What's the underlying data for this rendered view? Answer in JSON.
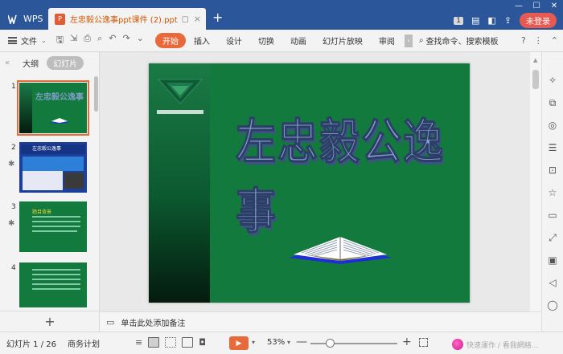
{
  "titlebar": {
    "app_tab_label": "WPS",
    "doc_tab_label": "左忠毅公逸事ppt课件 (2).ppt",
    "new_tab": "+",
    "page_badge": "1",
    "login_label": "未登录"
  },
  "menubar": {
    "file_label": "文件",
    "tabs": [
      "开始",
      "插入",
      "设计",
      "切换",
      "动画",
      "幻灯片放映",
      "审阅"
    ],
    "active_tab": "开始",
    "search_label": "查找命令、搜索模板",
    "help": "?"
  },
  "leftpanel": {
    "outline_tab": "大纲",
    "slides_tab": "幻灯片",
    "active_tab": "幻灯片",
    "thumbnails": [
      {
        "number": "1",
        "title": "左忠毅公逸事"
      },
      {
        "number": "2",
        "title": "左忠毅公逸事"
      },
      {
        "number": "3",
        "title": "题目背景"
      },
      {
        "number": "4",
        "title": ""
      }
    ],
    "add_slide": "+"
  },
  "slide": {
    "title": "左忠毅公逸事"
  },
  "notes": {
    "placeholder": "单击此处添加备注"
  },
  "statusbar": {
    "slide_counter": "幻灯片 1 / 26",
    "theme_name": "商务计划",
    "zoom_value": "53%",
    "zoom_level": 0.53,
    "zoom_minus": "—",
    "zoom_plus": "+",
    "right_text": "快速運作 / 看我網絡..."
  },
  "colors": {
    "title_bar": "#2b579a",
    "accent": "#e86a3b",
    "slide_bg": "#137a3e",
    "login": "#e65a52"
  }
}
